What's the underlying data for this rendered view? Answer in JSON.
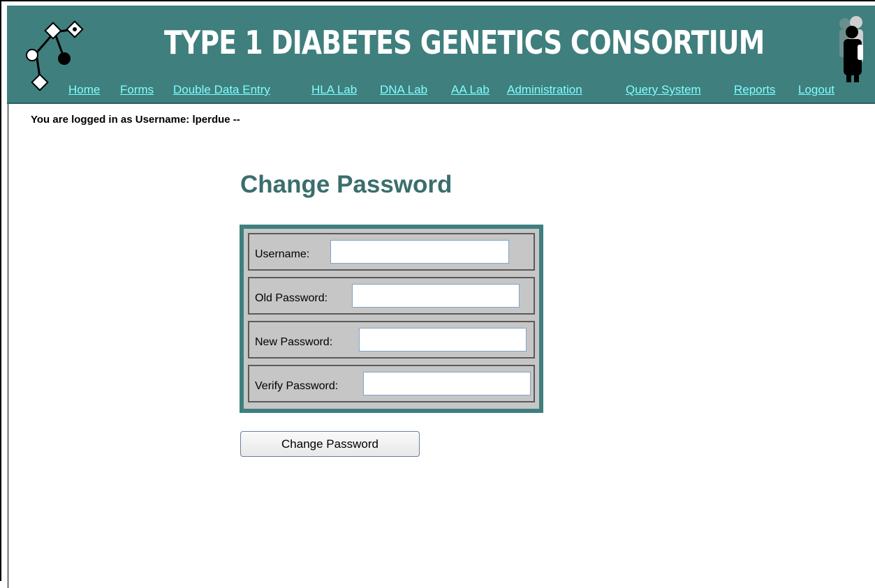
{
  "header": {
    "title": "TYPE 1 DIABETES GENETICS CONSORTIUM",
    "nav": [
      {
        "label": "Home"
      },
      {
        "label": "Forms"
      },
      {
        "label": "Double Data Entry"
      },
      {
        "label": "HLA Lab"
      },
      {
        "label": "DNA Lab"
      },
      {
        "label": "AA Lab"
      },
      {
        "label": "Administration"
      },
      {
        "label": "Query System"
      },
      {
        "label": "Reports"
      },
      {
        "label": "Logout"
      }
    ]
  },
  "session": {
    "login_text": "You are logged in as Username:  lperdue --"
  },
  "page": {
    "heading": "Change Password"
  },
  "form": {
    "fields": [
      {
        "label": "Username:",
        "value": ""
      },
      {
        "label": "Old Password:",
        "value": ""
      },
      {
        "label": "New Password:",
        "value": ""
      },
      {
        "label": "Verify Password:",
        "value": ""
      }
    ],
    "submit_label": "Change Password"
  },
  "colors": {
    "header_bg": "#3f7f7e",
    "nav_link": "#7fffff",
    "heading": "#3a6e6d",
    "form_bg": "#c6c6c6"
  }
}
